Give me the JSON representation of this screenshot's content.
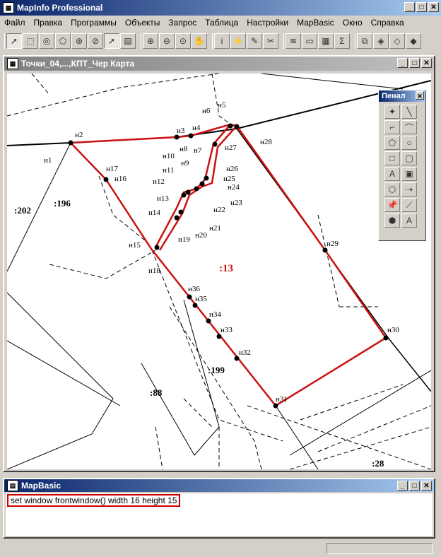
{
  "app": {
    "title": "MapInfo Professional",
    "controls": {
      "minimize": "_",
      "maximize": "□",
      "close": "✕"
    }
  },
  "menu": [
    "Файл",
    "Правка",
    "Программы",
    "Объекты",
    "Запрос",
    "Таблица",
    "Настройки",
    "MapBasic",
    "Окно",
    "Справка"
  ],
  "map_window": {
    "title": "Точки_04,...,КПТ_Чер Карта"
  },
  "palette": {
    "title": "Пенал",
    "close": "✕"
  },
  "mapbasic_window": {
    "title": "MapBasic",
    "command": "set window frontwindow() width 16 height 15"
  },
  "map": {
    "parcel_labels": {
      "p202": ":202",
      "p196": ":196",
      "p13": ":13",
      "p199": ":199",
      "p88": ":88",
      "p28": ":28"
    },
    "points": {
      "n1": "н1",
      "n2": "н2",
      "n3": "н3",
      "n4": "н4",
      "n5": "н5",
      "n6": "н6",
      "n7": "н7",
      "n8": "н8",
      "n9": "н9",
      "n10": "н10",
      "n11": "н11",
      "n12": "н12",
      "n13": "н13",
      "n14": "н14",
      "n15": "н15",
      "n16": "н16",
      "n17": "н17",
      "n18": "н18",
      "n19": "н19",
      "n20": "н20",
      "n21": "н21",
      "n22": "н22",
      "n23": "н23",
      "n24": "н24",
      "n25": "н25",
      "n26": "н26",
      "n27": "н27",
      "n28": "н28",
      "n29": "н29",
      "n30": "н30",
      "n31": "н31",
      "n32": "н32",
      "n33": "н33",
      "n34": "н34",
      "n35": "н35",
      "n36": "н36"
    },
    "colors": {
      "boundary": "#cc1111",
      "highlight_label": "#cc1111"
    }
  }
}
